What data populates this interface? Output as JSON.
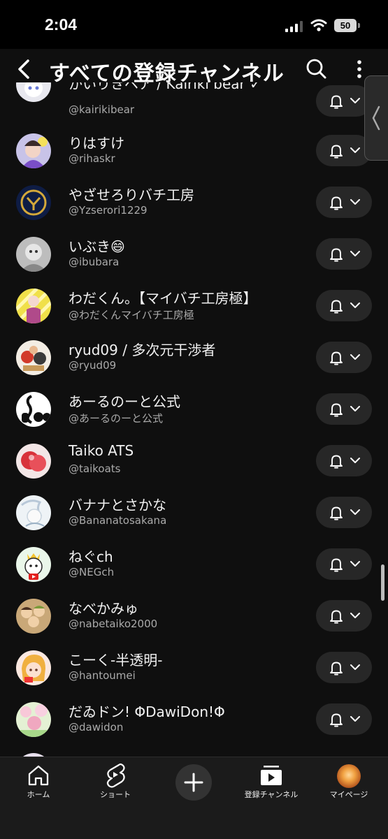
{
  "status_bar": {
    "time": "2:04",
    "battery": "50"
  },
  "header": {
    "title": "すべての登録チャンネル"
  },
  "channels": [
    {
      "name": "かいりきベア / Kairiki bear ✓",
      "handle": "@kairikibear"
    },
    {
      "name": "りはすけ",
      "handle": "@rihaskr"
    },
    {
      "name": "やざせろりバチ工房",
      "handle": "@Yzserori1229"
    },
    {
      "name": "いぶき😄",
      "handle": "@ibubara"
    },
    {
      "name": "わだくん。【マイバチ工房極】",
      "handle": "@わだくんマイバチ工房極"
    },
    {
      "name": "ryud09 / 多次元干渉者",
      "handle": "@ryud09"
    },
    {
      "name": "あーるのーと公式",
      "handle": "@あーるのーと公式"
    },
    {
      "name": "Taiko ATS",
      "handle": "@taikoats"
    },
    {
      "name": "バナナとさかな",
      "handle": "@Bananatosakana"
    },
    {
      "name": "ねぐch",
      "handle": "@NEGch"
    },
    {
      "name": "なべかみゅ",
      "handle": "@nabetaiko2000"
    },
    {
      "name": "こーく-半透明-",
      "handle": "@hantoumei"
    },
    {
      "name": "だゐドン!  ΦDawiDon!Φ",
      "handle": "@dawidon"
    },
    {
      "name": "",
      "handle": ""
    }
  ],
  "bottom_nav": {
    "home": "ホーム",
    "shorts": "ショート",
    "subscriptions": "登録チャンネル",
    "you": "マイページ"
  },
  "colors": {
    "background": "#0f0f0f",
    "pill": "#272727",
    "secondary_text": "#aaaaaa"
  }
}
